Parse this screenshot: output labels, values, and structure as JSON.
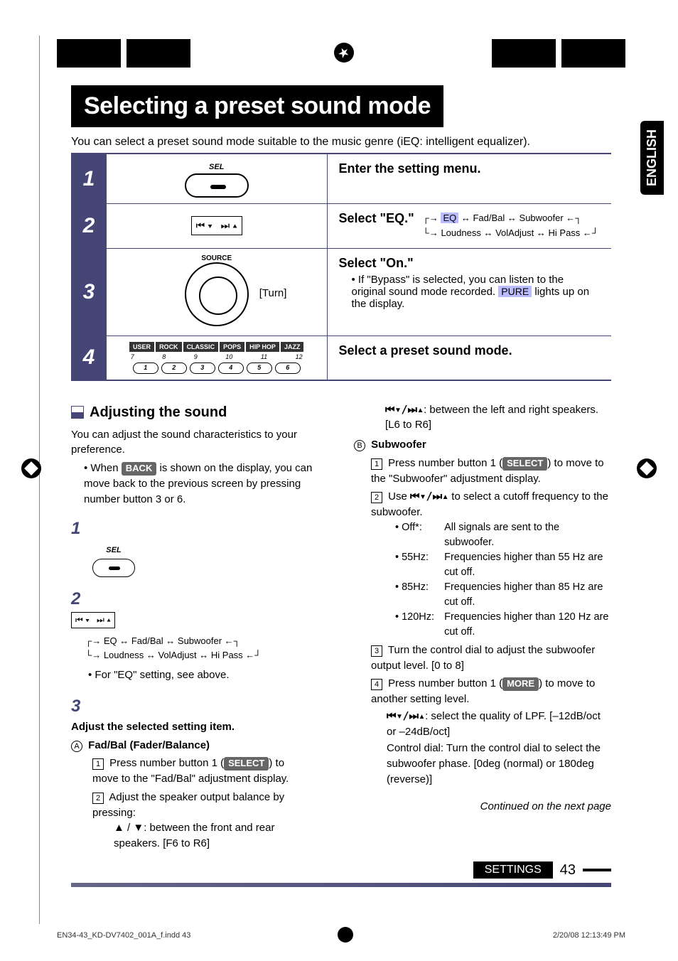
{
  "language_tab": "ENGLISH",
  "main_title": "Selecting a preset sound mode",
  "intro": "You can select a preset sound mode suitable to the music genre (iEQ: intelligent equalizer).",
  "steps": [
    {
      "num": "1",
      "img_label": "SEL",
      "desc_bold": "Enter the setting menu.",
      "desc_rest": ""
    },
    {
      "num": "2",
      "img_label": "",
      "desc_bold": "Select \"EQ.\"",
      "desc_rest": ""
    },
    {
      "num": "3",
      "img_label": "SOURCE",
      "turn": "[Turn]",
      "desc_bold": "Select \"On.\"",
      "desc_bullet": "If \"Bypass\" is selected, you can listen to the original sound mode recorded. ",
      "desc_badge": "PURE",
      "desc_after_badge": " lights up on the display."
    },
    {
      "num": "4",
      "desc_bold": "Select a preset sound mode.",
      "eq_presets": [
        "USER",
        "ROCK",
        "CLASSIC",
        "POPS",
        "HIP HOP",
        "JAZZ"
      ],
      "eq_nums_top": [
        "7",
        "8",
        "9",
        "10",
        "11",
        "12"
      ],
      "eq_nums_bot": [
        "1",
        "2",
        "3",
        "4",
        "5",
        "6"
      ]
    }
  ],
  "menu_flow": {
    "row1": [
      "EQ",
      "Fad/Bal",
      "Subwoofer"
    ],
    "row2": [
      "Loudness",
      "VolAdjust",
      "Hi Pass"
    ]
  },
  "adjusting": {
    "title": "Adjusting the sound",
    "intro": "You can adjust the sound characteristics to your preference.",
    "back_note_pre": "When ",
    "back_pill": "BACK",
    "back_note_post": " is shown on the display, you can move back to the previous screen by pressing number button 3 or 6.",
    "step1_label": "SEL",
    "menu_note": "For \"EQ\" setting, see above.",
    "step3_title": "Adjust the selected setting item.",
    "fadbal": {
      "label": "Fad/Bal (Fader/Balance)",
      "item1_pre": "Press number button 1 (",
      "item1_pill": "SELECT",
      "item1_post": ") to move to the \"Fad/Bal\" adjustment display.",
      "item2": "Adjust the speaker output balance by pressing:",
      "item2a": "▲ / ▼: between the front and rear speakers. [F6 to R6]"
    }
  },
  "right_col": {
    "lr_note": ": between the left and right speakers. [L6 to R6]",
    "sub_label": "Subwoofer",
    "sub1_pre": "Press number button 1 (",
    "sub1_pill": "SELECT",
    "sub1_post": ") to move to the \"Subwoofer\" adjustment display.",
    "sub2": " to select a cutoff frequency to the subwoofer.",
    "sub2_pre": "Use ",
    "freq": [
      {
        "label": "Off*:",
        "desc": "All signals are sent to the subwoofer."
      },
      {
        "label": "55Hz:",
        "desc": "Frequencies higher than 55 Hz are cut off."
      },
      {
        "label": "85Hz:",
        "desc": "Frequencies higher than 85 Hz are cut off."
      },
      {
        "label": "120Hz:",
        "desc": "Frequencies higher than 120 Hz are cut off."
      }
    ],
    "sub3": "Turn the control dial to adjust the subwoofer output level. [0 to 8]",
    "sub4_pre": "Press number button 1 (",
    "sub4_pill": "MORE",
    "sub4_post": ") to move to another setting level.",
    "sub4a": ": select the quality of LPF. [–12dB/oct or –24dB/oct]",
    "sub4b": "Control dial: Turn the control dial to select the subwoofer phase. [0deg (normal) or 180deg (reverse)]"
  },
  "continued": "Continued on the next page",
  "footer_label": "SETTINGS",
  "page_num": "43",
  "file_footer_left": "EN34-43_KD-DV7402_001A_f.indd   43",
  "file_footer_right": "2/20/08   12:13:49 PM"
}
